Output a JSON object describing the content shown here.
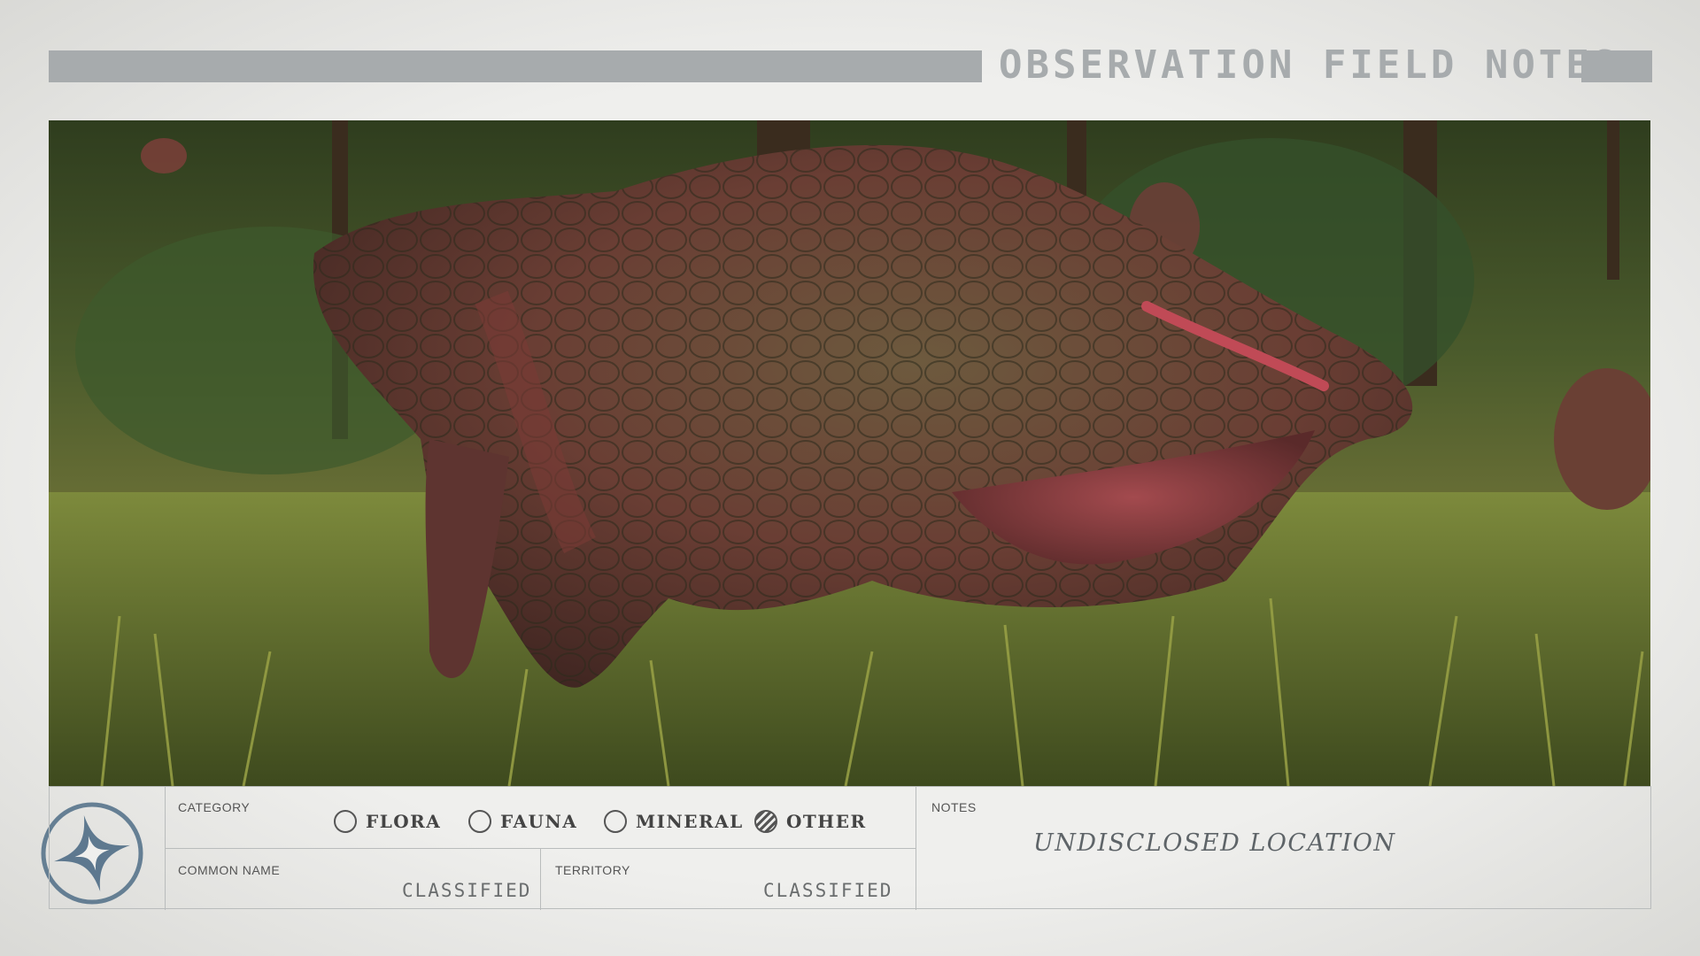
{
  "header": {
    "title": "OBSERVATION FIELD NOTES"
  },
  "photo": {
    "subject": "creature-photo"
  },
  "form": {
    "category": {
      "label": "CATEGORY",
      "options": [
        {
          "label": "FLORA",
          "selected": false
        },
        {
          "label": "FAUNA",
          "selected": false
        },
        {
          "label": "MINERAL",
          "selected": false
        },
        {
          "label": "OTHER",
          "selected": true
        }
      ]
    },
    "common_name": {
      "label": "COMMON NAME",
      "value": "CLASSIFIED"
    },
    "territory": {
      "label": "TERRITORY",
      "value": "CLASSIFIED"
    },
    "notes": {
      "label": "NOTES",
      "value": "UNDISCLOSED LOCATION"
    }
  },
  "colors": {
    "paper": "#efefed",
    "header_gray": "#a7abad",
    "ink": "#444444",
    "emblem": "#4f6d86"
  },
  "icons": {
    "emblem": "compass-star-emblem-icon"
  }
}
